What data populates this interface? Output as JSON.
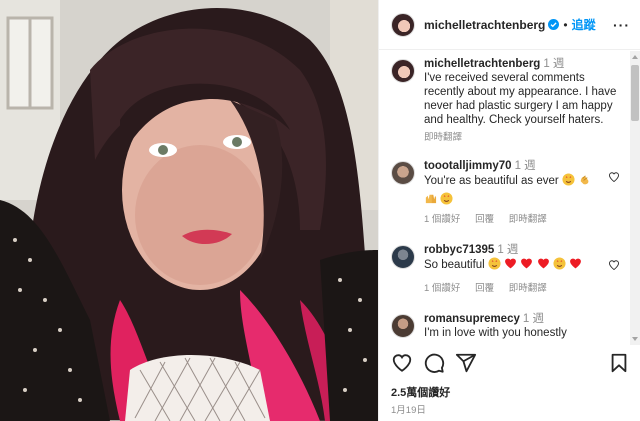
{
  "post": {
    "username": "michelletrachtenberg",
    "follow_label": "追蹤",
    "more_icon": "more-horizontal-icon",
    "caption_time": "1 週",
    "caption": "I've received several comments recently about my appearance. I have never had plastic surgery I am happy and healthy. Check yourself haters.",
    "caption_translate": "即時翻譯",
    "likes": "2.5萬個讚好",
    "date": "1月19日"
  },
  "comments": [
    {
      "username": "toootalljimmy70",
      "time": "1 週",
      "text": "You're as beautiful as ever",
      "likes_label": "1 個讚好",
      "reply_label": "回覆",
      "translate_label": "即時翻譯"
    },
    {
      "username": "robbyc71395",
      "time": "1 週",
      "text": "So beautiful",
      "likes_label": "1 個讚好",
      "reply_label": "回覆",
      "translate_label": "即時翻譯"
    },
    {
      "username": "romansupremecy",
      "time": "1 週",
      "text": "I'm in love with you honestly"
    }
  ],
  "icons": {
    "like": "heart-icon",
    "comment": "comment-icon",
    "share": "share-icon",
    "save": "bookmark-icon"
  },
  "colors": {
    "accent": "#0095f6",
    "muted": "#8e8e8e",
    "text": "#262626",
    "heart_red": "#ed1c24"
  }
}
